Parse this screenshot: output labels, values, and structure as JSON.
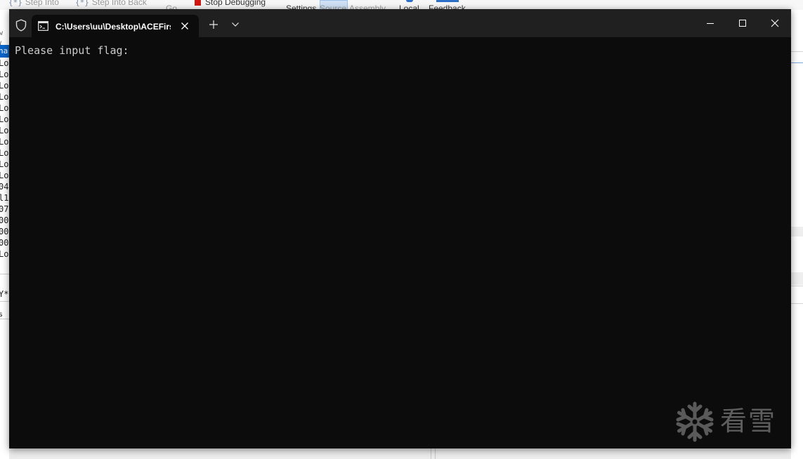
{
  "background_app": {
    "toolbar": {
      "step_into": "Step Into",
      "step_into_back": "Step Into Back",
      "go": "Go",
      "stop_debugging": "Stop Debugging",
      "settings": "Settings",
      "source": "Source",
      "assembly": "Assembly",
      "local": "Local",
      "feedback": "Feedback"
    },
    "left_fragments": {
      "top_label": "w (",
      "selected_row": "na",
      "rows": [
        "Lo",
        "Lo",
        "Lo",
        "Lo",
        "Lo",
        "Lo",
        "Lo",
        "Lo",
        "Lo",
        "Lo",
        "Lo",
        "04",
        "l1",
        "07",
        "00",
        "00",
        "00",
        "Lo"
      ],
      "lower_label_1": "Y*",
      "lower_label_2": "s"
    }
  },
  "terminal": {
    "tab_title": "C:\\Users\\uu\\Desktop\\ACEFirst",
    "console_lines": [
      "Please input flag:"
    ],
    "colors": {
      "background": "#0c0c0c",
      "titlebar": "#202020",
      "text": "#cccccc"
    }
  },
  "watermark": {
    "text": "看雪"
  }
}
